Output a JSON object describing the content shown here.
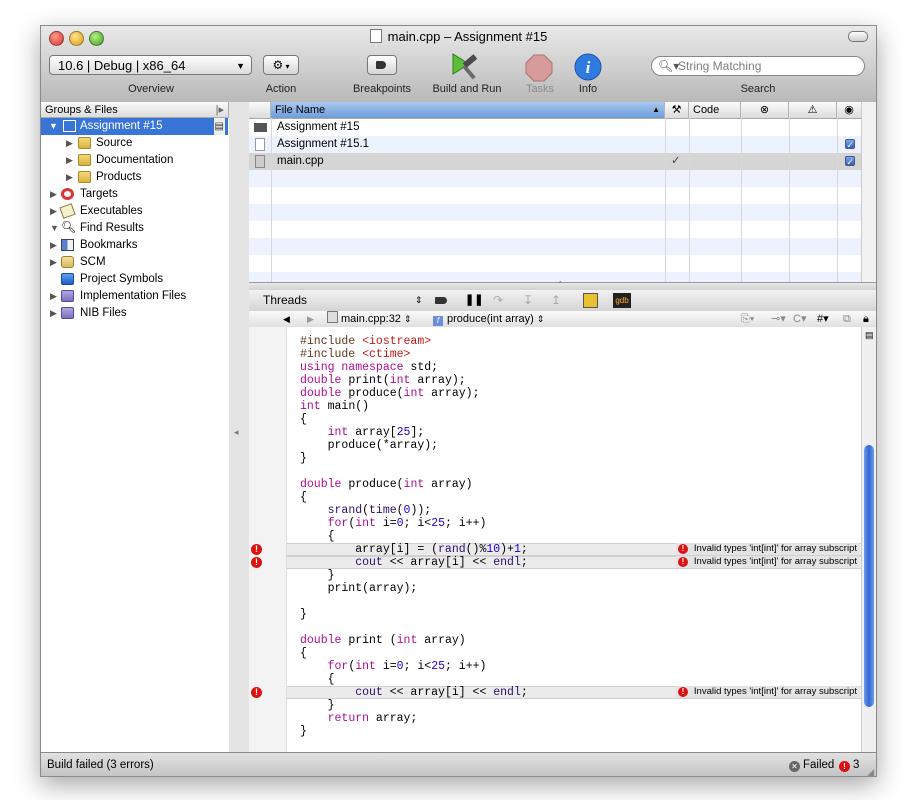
{
  "window": {
    "title": "main.cpp – Assignment #15"
  },
  "toolbar": {
    "overview_value": "10.6 | Debug | x86_64",
    "overview_label": "Overview",
    "action_label": "Action",
    "breakpoints_label": "Breakpoints",
    "build_run_label": "Build and Run",
    "tasks_label": "Tasks",
    "info_label": "Info",
    "search_placeholder": "String Matching",
    "search_label": "Search"
  },
  "sidebar": {
    "header": "Groups & Files",
    "items": [
      {
        "label": "Assignment #15",
        "icon": "project-icon",
        "selected": true
      },
      {
        "label": "Source",
        "icon": "folder-icon"
      },
      {
        "label": "Documentation",
        "icon": "folder-icon"
      },
      {
        "label": "Products",
        "icon": "folder-icon"
      },
      {
        "label": "Targets",
        "icon": "target-icon"
      },
      {
        "label": "Executables",
        "icon": "executable-icon"
      },
      {
        "label": "Find Results",
        "icon": "magnifier-icon"
      },
      {
        "label": "Bookmarks",
        "icon": "bookmarks-icon"
      },
      {
        "label": "SCM",
        "icon": "scm-icon"
      },
      {
        "label": "Project Symbols",
        "icon": "cube-icon"
      },
      {
        "label": "Implementation Files",
        "icon": "smart-group-icon"
      },
      {
        "label": "NIB Files",
        "icon": "smart-group-icon"
      }
    ]
  },
  "file_table": {
    "columns": {
      "name": "File Name",
      "code": "Code"
    },
    "rows": [
      {
        "name": "Assignment #15",
        "icon": "project-icon",
        "build_check": "",
        "target_checked": false
      },
      {
        "name": "Assignment #15.1",
        "icon": "document-icon",
        "build_check": "",
        "target_checked": true
      },
      {
        "name": "main.cpp",
        "icon": "cpp-file-icon",
        "build_check": "✓",
        "target_checked": true
      }
    ]
  },
  "debugger_bar": {
    "threads_label": "Threads"
  },
  "nav_bar": {
    "file_location": "main.cpp:32",
    "function": "produce(int array)",
    "counterpart_label": "C",
    "pragma_label": "#"
  },
  "code": {
    "lines": [
      {
        "parts": [
          [
            "pp",
            "#include "
          ],
          [
            "str",
            "<iostream>"
          ]
        ]
      },
      {
        "parts": [
          [
            "pp",
            "#include "
          ],
          [
            "str",
            "<ctime>"
          ]
        ]
      },
      {
        "parts": [
          [
            "kw",
            "using namespace"
          ],
          [
            "",
            " std;"
          ]
        ]
      },
      {
        "parts": [
          [
            "kw",
            "double"
          ],
          [
            "",
            " print("
          ],
          [
            "kw",
            "int"
          ],
          [
            "",
            " array);"
          ]
        ]
      },
      {
        "parts": [
          [
            "kw",
            "double"
          ],
          [
            "",
            " produce("
          ],
          [
            "kw",
            "int"
          ],
          [
            "",
            " array);"
          ]
        ]
      },
      {
        "parts": [
          [
            "kw",
            "int"
          ],
          [
            "",
            " main()"
          ]
        ]
      },
      {
        "parts": [
          [
            "",
            "{"
          ]
        ]
      },
      {
        "parts": [
          [
            "",
            "    "
          ],
          [
            "kw",
            "int"
          ],
          [
            "",
            " array["
          ],
          [
            "num",
            "25"
          ],
          [
            "",
            "];"
          ]
        ]
      },
      {
        "parts": [
          [
            "",
            "    produce(*array);"
          ]
        ]
      },
      {
        "parts": [
          [
            "",
            "}"
          ]
        ]
      },
      {
        "parts": []
      },
      {
        "parts": [
          [
            "kw",
            "double"
          ],
          [
            "",
            " produce("
          ],
          [
            "kw",
            "int"
          ],
          [
            "",
            " array)"
          ]
        ]
      },
      {
        "parts": [
          [
            "",
            "{"
          ]
        ]
      },
      {
        "parts": [
          [
            "",
            "    "
          ],
          [
            "fn",
            "srand"
          ],
          [
            "",
            "("
          ],
          [
            "fn",
            "time"
          ],
          [
            "",
            "("
          ],
          [
            "num",
            "0"
          ],
          [
            "",
            "));"
          ]
        ]
      },
      {
        "parts": [
          [
            "",
            "    "
          ],
          [
            "kw",
            "for"
          ],
          [
            "",
            "("
          ],
          [
            "kw",
            "int"
          ],
          [
            "",
            " i="
          ],
          [
            "num",
            "0"
          ],
          [
            "",
            "; i<"
          ],
          [
            "num",
            "25"
          ],
          [
            "",
            "; i++)"
          ]
        ]
      },
      {
        "parts": [
          [
            "",
            "    {"
          ]
        ]
      },
      {
        "parts": [
          [
            "",
            "        array[i] = ("
          ],
          [
            "fn",
            "rand"
          ],
          [
            "",
            "()%"
          ],
          [
            "num",
            "10"
          ],
          [
            "",
            ")+"
          ],
          [
            "num",
            "1"
          ],
          [
            "",
            ";"
          ]
        ],
        "error": "Invalid types 'int[int]' for array subscript"
      },
      {
        "parts": [
          [
            "",
            "        "
          ],
          [
            "fn",
            "cout"
          ],
          [
            "",
            " << array[i] << "
          ],
          [
            "fn",
            "endl"
          ],
          [
            "",
            ";"
          ]
        ],
        "error": "Invalid types 'int[int]' for array subscript"
      },
      {
        "parts": [
          [
            "",
            "    }"
          ]
        ]
      },
      {
        "parts": [
          [
            "",
            "    print(array);"
          ]
        ]
      },
      {
        "parts": []
      },
      {
        "parts": [
          [
            "",
            "}"
          ]
        ]
      },
      {
        "parts": []
      },
      {
        "parts": [
          [
            "kw",
            "double"
          ],
          [
            "",
            " print ("
          ],
          [
            "kw",
            "int"
          ],
          [
            "",
            " array)"
          ]
        ]
      },
      {
        "parts": [
          [
            "",
            "{"
          ]
        ]
      },
      {
        "parts": [
          [
            "",
            "    "
          ],
          [
            "kw",
            "for"
          ],
          [
            "",
            "("
          ],
          [
            "kw",
            "int"
          ],
          [
            "",
            " i="
          ],
          [
            "num",
            "0"
          ],
          [
            "",
            "; i<"
          ],
          [
            "num",
            "25"
          ],
          [
            "",
            "; i++)"
          ]
        ]
      },
      {
        "parts": [
          [
            "",
            "    {"
          ]
        ]
      },
      {
        "parts": [
          [
            "",
            "        "
          ],
          [
            "fn",
            "cout"
          ],
          [
            "",
            " << array[i] << "
          ],
          [
            "fn",
            "endl"
          ],
          [
            "",
            ";"
          ]
        ],
        "error": "Invalid types 'int[int]' for array subscript"
      },
      {
        "parts": [
          [
            "",
            "    }"
          ]
        ]
      },
      {
        "parts": [
          [
            "",
            "    "
          ],
          [
            "kw",
            "return"
          ],
          [
            "",
            " array;"
          ]
        ]
      },
      {
        "parts": [
          [
            "",
            "}"
          ]
        ]
      }
    ]
  },
  "status": {
    "message": "Build failed (3 errors)",
    "result": "Failed",
    "error_count": "3"
  },
  "colors": {
    "selection": "#3875d7",
    "error": "#dd1111",
    "keyword": "#aa0d91",
    "string": "#c41a16",
    "number": "#1c00cf"
  }
}
